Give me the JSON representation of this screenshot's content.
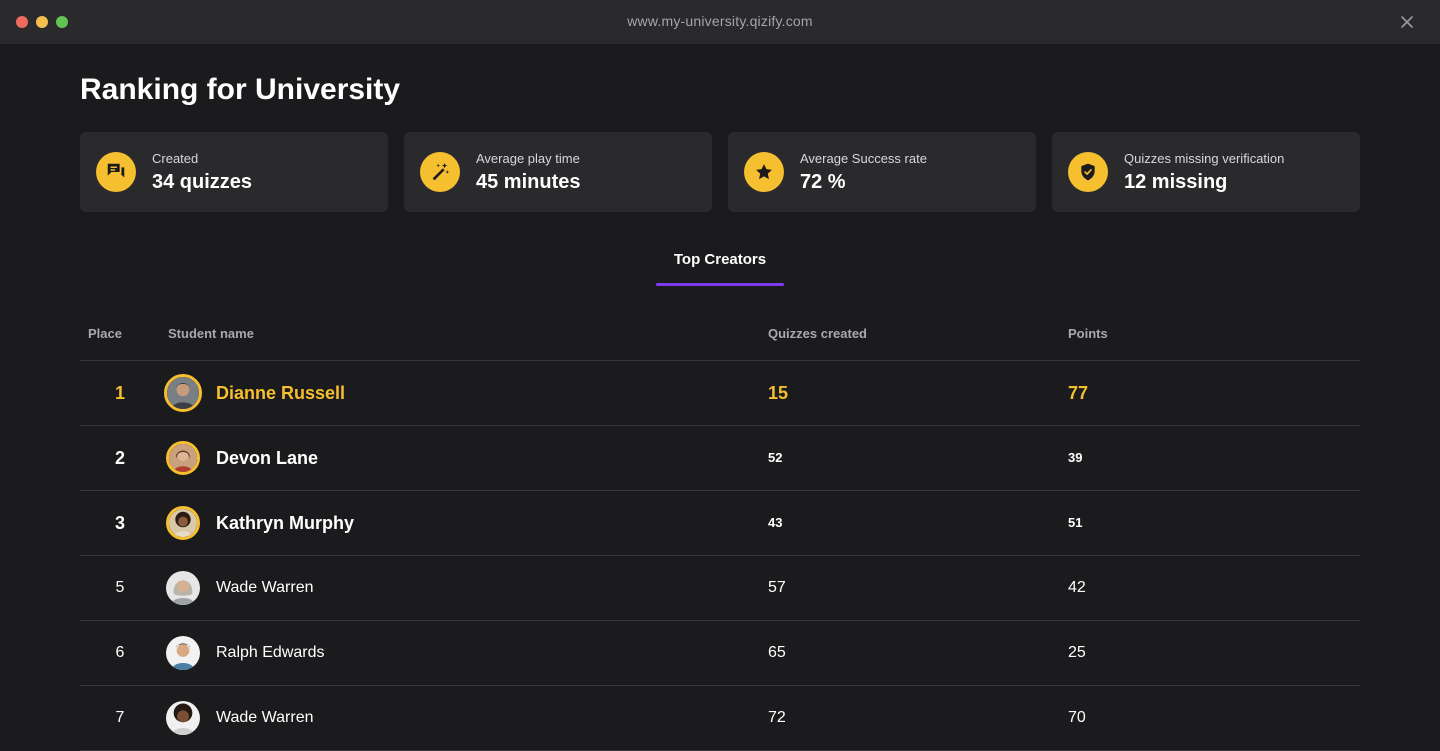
{
  "window": {
    "url": "www.my-university.qizify.com"
  },
  "page": {
    "title": "Ranking for University"
  },
  "stats": [
    {
      "label": "Created",
      "value": "34 quizzes",
      "icon": "chat-bubbles-icon"
    },
    {
      "label": "Average play time",
      "value": "45 minutes",
      "icon": "magic-wand-icon"
    },
    {
      "label": "Average Success rate",
      "value": "72 %",
      "icon": "star-icon"
    },
    {
      "label": "Quizzes missing verification",
      "value": "12 missing",
      "icon": "shield-check-icon"
    }
  ],
  "tabs": {
    "active": "Top Creators"
  },
  "table": {
    "headers": {
      "place": "Place",
      "name": "Student name",
      "quizzes": "Quizzes created",
      "points": "Points"
    },
    "rows": [
      {
        "place": "1",
        "name": "Dianne Russell",
        "quizzes": "15",
        "points": "77"
      },
      {
        "place": "2",
        "name": "Devon Lane",
        "quizzes": "52",
        "points": "39"
      },
      {
        "place": "3",
        "name": "Kathryn Murphy",
        "quizzes": "43",
        "points": "51"
      },
      {
        "place": "5",
        "name": "Wade Warren",
        "quizzes": "57",
        "points": "42"
      },
      {
        "place": "6",
        "name": "Ralph Edwards",
        "quizzes": "65",
        "points": "25"
      },
      {
        "place": "7",
        "name": "Wade Warren",
        "quizzes": "72",
        "points": "70"
      }
    ]
  },
  "colors": {
    "accent_gold": "#f5bf2f",
    "tab_underline": "#7c3aed",
    "background": "#1b1b1d",
    "card": "#2a2a2d"
  }
}
